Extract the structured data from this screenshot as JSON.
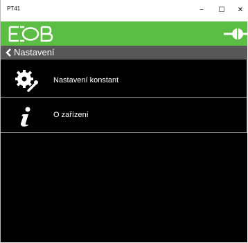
{
  "window": {
    "title": "PT41",
    "minimize": "−",
    "maximize": "☐",
    "close": "✕"
  },
  "header": {
    "brand_color": "#5cbd44",
    "logo_icon": "eob-logo",
    "plug_icon": "plug-icon"
  },
  "nav": {
    "back_label": "Nastavení"
  },
  "menu": [
    {
      "label": "Nastavení konstant",
      "icon": "gear-wrench-icon"
    },
    {
      "label": "O zařízení",
      "icon": "info-icon"
    }
  ]
}
